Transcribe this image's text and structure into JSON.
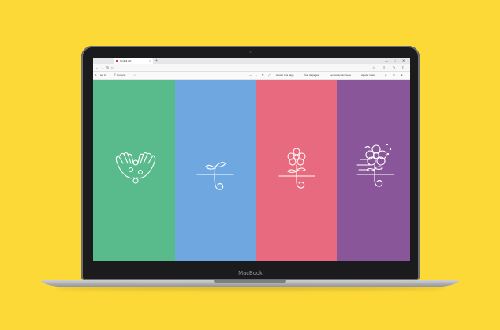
{
  "colors": {
    "background": "#fcd937",
    "green": "#59ba8c",
    "blue": "#6fa8e1",
    "pink": "#e86a7e",
    "purple": "#8a569a"
  },
  "browser": {
    "tab_title": "Tonlibil.pdf",
    "new_tab": "+",
    "url": "",
    "win_buttons": [
      "—",
      "□",
      "✕"
    ],
    "pdf_toolbar": {
      "page_counter": "sur 21",
      "contents": "Contenu",
      "zoom_minus": "—",
      "zoom_plus": "+",
      "fit_page": "Ajuster à la page",
      "page_view": "Vue de pages",
      "read_aloud": "Lecture à voix haute",
      "add_notes": "Ajouter notes"
    }
  },
  "device": {
    "brand": "MacBook"
  },
  "panels": [
    {
      "name": "hands-seeds",
      "color_key": "green"
    },
    {
      "name": "sprout",
      "color_key": "blue"
    },
    {
      "name": "flower",
      "color_key": "pink"
    },
    {
      "name": "flower-bloom",
      "color_key": "purple"
    }
  ]
}
